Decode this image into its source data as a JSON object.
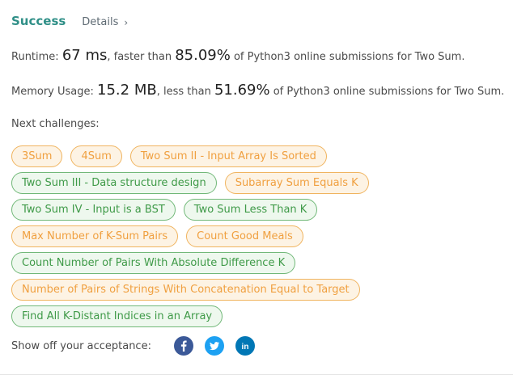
{
  "header": {
    "status": "Success",
    "details_label": "Details",
    "details_chevron": "›"
  },
  "runtime": {
    "label": "Runtime: ",
    "value": "67 ms",
    "middle": ", faster than ",
    "percent": "85.09%",
    "suffix": " of Python3 online submissions for Two Sum."
  },
  "memory": {
    "label": "Memory Usage: ",
    "value": "15.2 MB",
    "middle": ", less than ",
    "percent": "51.69%",
    "suffix": " of Python3 online submissions for Two Sum."
  },
  "next_challenges": {
    "label": "Next challenges:",
    "rows": [
      [
        {
          "title": "3Sum",
          "difficulty": "medium"
        },
        {
          "title": "4Sum",
          "difficulty": "medium"
        },
        {
          "title": "Two Sum II - Input Array Is Sorted",
          "difficulty": "medium"
        }
      ],
      [
        {
          "title": "Two Sum III - Data structure design",
          "difficulty": "easy"
        },
        {
          "title": "Subarray Sum Equals K",
          "difficulty": "medium"
        }
      ],
      [
        {
          "title": "Two Sum IV - Input is a BST",
          "difficulty": "easy"
        },
        {
          "title": "Two Sum Less Than K",
          "difficulty": "easy"
        }
      ],
      [
        {
          "title": "Max Number of K-Sum Pairs",
          "difficulty": "medium"
        },
        {
          "title": "Count Good Meals",
          "difficulty": "medium"
        }
      ],
      [
        {
          "title": "Count Number of Pairs With Absolute Difference K",
          "difficulty": "easy"
        }
      ],
      [
        {
          "title": "Number of Pairs of Strings With Concatenation Equal to Target",
          "difficulty": "medium"
        }
      ],
      [
        {
          "title": "Find All K-Distant Indices in an Array",
          "difficulty": "easy"
        }
      ]
    ]
  },
  "share": {
    "label": "Show off your acceptance:",
    "buttons": [
      {
        "icon": "facebook-icon",
        "color": "#3b5998",
        "glyph": "f"
      },
      {
        "icon": "twitter-icon",
        "color": "#1da1f2",
        "glyph": "t"
      },
      {
        "icon": "linkedin-icon",
        "color": "#0077b5",
        "glyph": "in"
      }
    ]
  },
  "colors": {
    "success": "#2f8f87",
    "medium_text": "#f0a040",
    "medium_bg": "#fdf3e4",
    "easy_text": "#3f9a48",
    "easy_bg": "#eef8ee"
  }
}
